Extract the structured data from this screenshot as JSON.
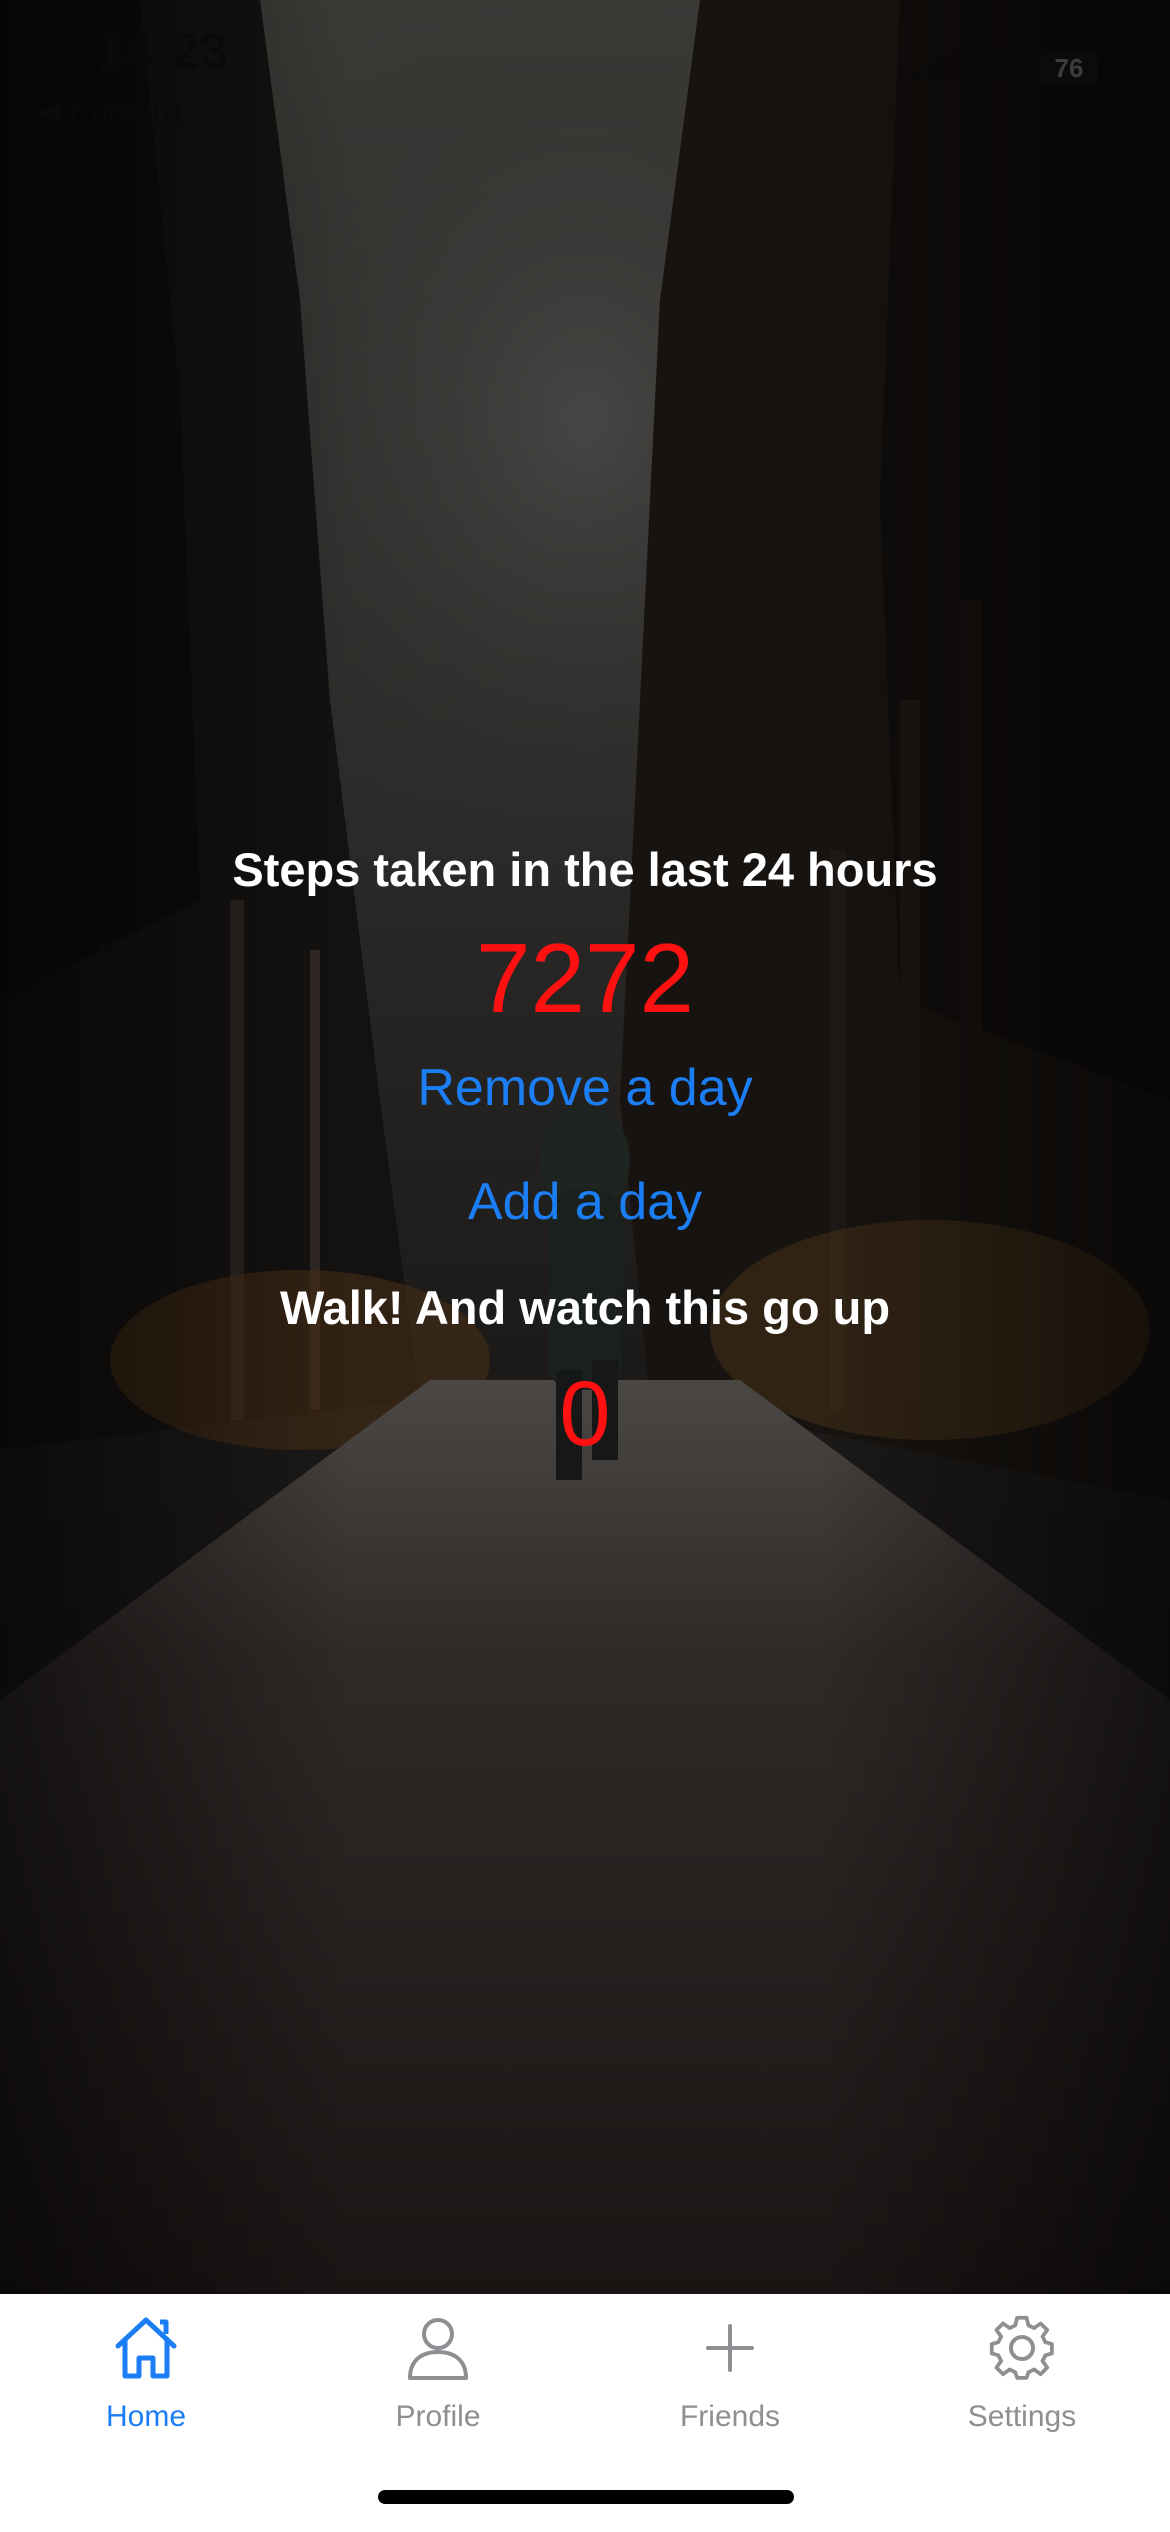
{
  "status_bar": {
    "time": "14:23",
    "back_label": "◀ Kamera",
    "battery": "76"
  },
  "main": {
    "steps_title": "Steps taken in the last 24 hours",
    "steps_value": "7272",
    "remove_day_label": "Remove a day",
    "add_day_label": "Add a day",
    "walk_title": "Walk! And watch this go up",
    "walk_value": "0"
  },
  "tab_bar": {
    "tabs": [
      {
        "label": "Home",
        "icon": "home-icon",
        "active": true
      },
      {
        "label": "Profile",
        "icon": "person-icon",
        "active": false
      },
      {
        "label": "Friends",
        "icon": "plus-icon",
        "active": false
      },
      {
        "label": "Settings",
        "icon": "gear-icon",
        "active": false
      }
    ]
  },
  "colors": {
    "accent": "#1b7ef5",
    "value_red": "#ff1111",
    "tab_inactive": "#8e8e93",
    "tab_bar_bg": "#ffffff"
  }
}
